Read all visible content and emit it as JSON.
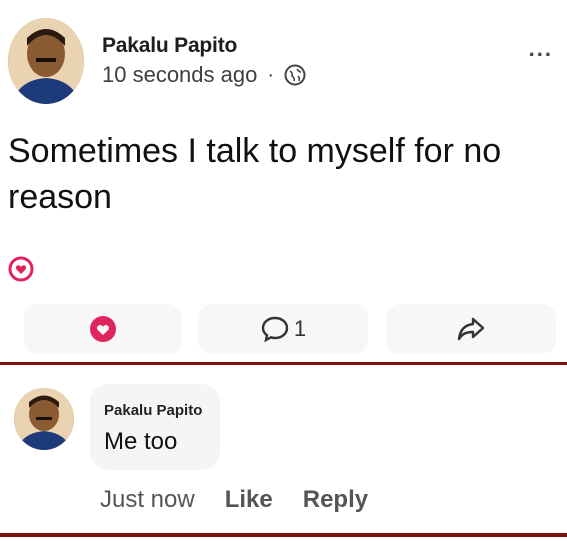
{
  "post": {
    "author": "Pakalu Papito",
    "timestamp": "10 seconds ago",
    "meta_separator": "·",
    "audience_icon": "globe-icon",
    "more_icon": "more-options-icon",
    "more_label": "...",
    "text": "Sometimes I talk to myself for no reason",
    "reaction_icon": "love-reaction-icon",
    "reaction_color": "#e0245e"
  },
  "actions": {
    "love_icon": "love-reaction-icon",
    "comment_icon": "comment-icon",
    "comment_count": "1",
    "share_icon": "share-icon"
  },
  "comment": {
    "author": "Pakalu Papito",
    "text": "Me too",
    "time": "Just now",
    "like_label": "Like",
    "reply_label": "Reply"
  },
  "colors": {
    "divider": "#7a1010",
    "love_red": "#e0245e"
  }
}
